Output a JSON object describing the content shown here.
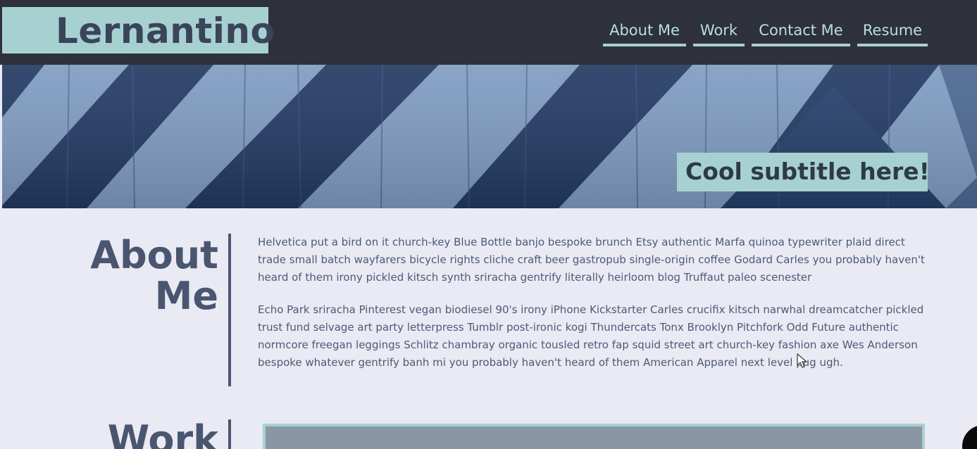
{
  "header": {
    "logo": "Lernantino",
    "nav": [
      {
        "label": "About Me"
      },
      {
        "label": "Work"
      },
      {
        "label": "Contact Me"
      },
      {
        "label": "Resume"
      }
    ]
  },
  "hero": {
    "subtitle": "Cool subtitle here!"
  },
  "about": {
    "title_line1": "About",
    "title_line2": "Me",
    "paragraph1_line1": "Helvetica put a bird on it church-key Blue Bottle banjo bespoke brunch Etsy authentic Marfa quinoa typewriter plaid direct",
    "paragraph1_line2": "trade small batch wayfarers bicycle rights cliche craft beer gastropub single-origin coffee Godard Carles you probably haven't",
    "paragraph1_line3": "heard of them irony pickled kitsch synth sriracha gentrify literally heirloom blog Truffaut paleo scenester",
    "paragraph2_line1": "Echo Park sriracha Pinterest vegan biodiesel 90's irony iPhone Kickstarter Carles crucifix kitsch narwhal dreamcatcher pickled",
    "paragraph2_line2": "trust fund selvage art party letterpress Tumblr post-ironic kogi Thundercats Tonx Brooklyn Pitchfork Odd Future authentic",
    "paragraph2_line3": "normcore freegan leggings Schlitz chambray organic tousled retro fap squid street art church-key fashion axe Wes Anderson",
    "paragraph2_line4": "bespoke whatever gentrify banh mi you probably haven't heard of them American Apparel next level pug ugh."
  },
  "work": {
    "title": "Work"
  },
  "colors": {
    "header_bg": "#2e3139",
    "accent": "#a7d1d1",
    "page_bg": "#e9eaf4",
    "text": "#4a5670"
  }
}
